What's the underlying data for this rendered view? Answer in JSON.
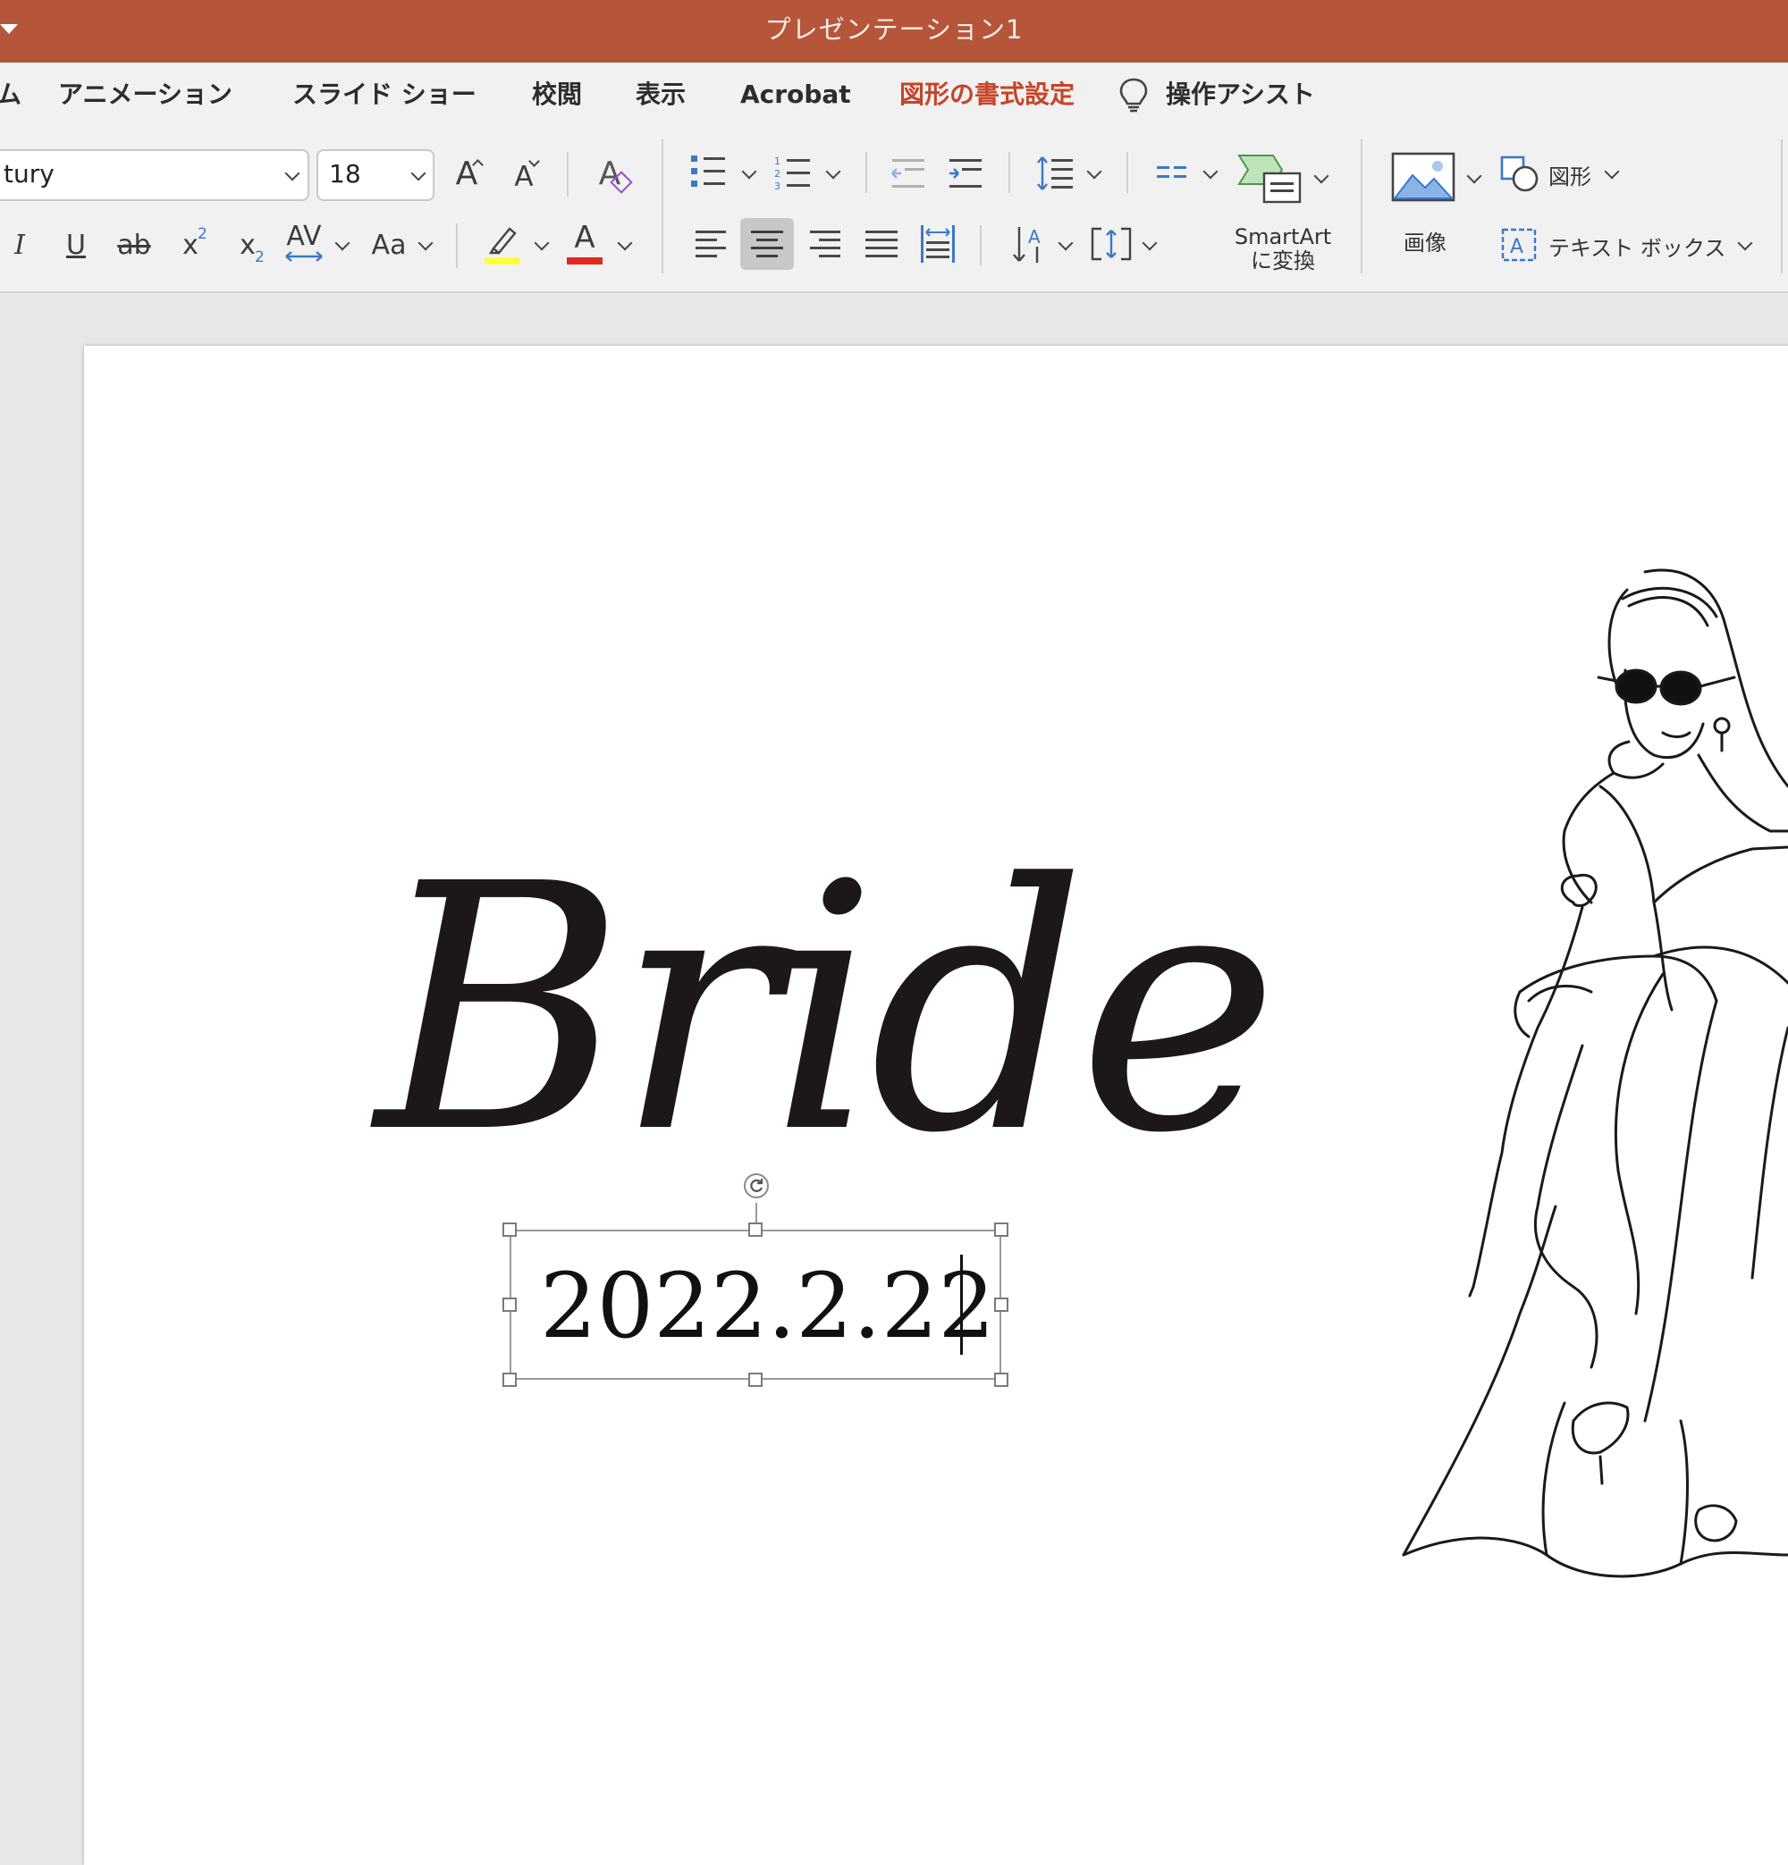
{
  "window": {
    "title": "プレゼンテーション1"
  },
  "ribbon": {
    "tabs": [
      {
        "label": "ム",
        "active": false
      },
      {
        "label": "アニメーション",
        "active": false
      },
      {
        "label": "スライド ショー",
        "active": false
      },
      {
        "label": "校閲",
        "active": false
      },
      {
        "label": "表示",
        "active": false
      },
      {
        "label": "Acrobat",
        "active": false
      },
      {
        "label": "図形の書式設定",
        "active": true
      }
    ],
    "tell_me": "操作アシスト",
    "font_name": "tury",
    "font_size": "18",
    "formatting": {
      "italic": "I",
      "underline": "U",
      "strikethrough": "ab",
      "superscript": "x",
      "superscript_mark": "2",
      "subscript": "x",
      "subscript_mark": "2",
      "char_spacing": "AV",
      "change_case": "Aa",
      "font_color_letter": "A",
      "highlight_color": "#ffff40",
      "font_color": "#e0281e"
    },
    "grow_font": "A",
    "shrink_font": "A",
    "clear_format": "A",
    "smartart": {
      "line1": "SmartArt",
      "line2": "に変換"
    },
    "picture_label": "画像",
    "shapes_label": "図形",
    "textbox_label": "テキスト ボックス"
  },
  "slide": {
    "title_text": "Bride",
    "date_text": "2022.2.22"
  },
  "colors": {
    "titlebar": "#b5553a",
    "active_tab": "#c64428",
    "accent_blue": "#3b78c8"
  }
}
